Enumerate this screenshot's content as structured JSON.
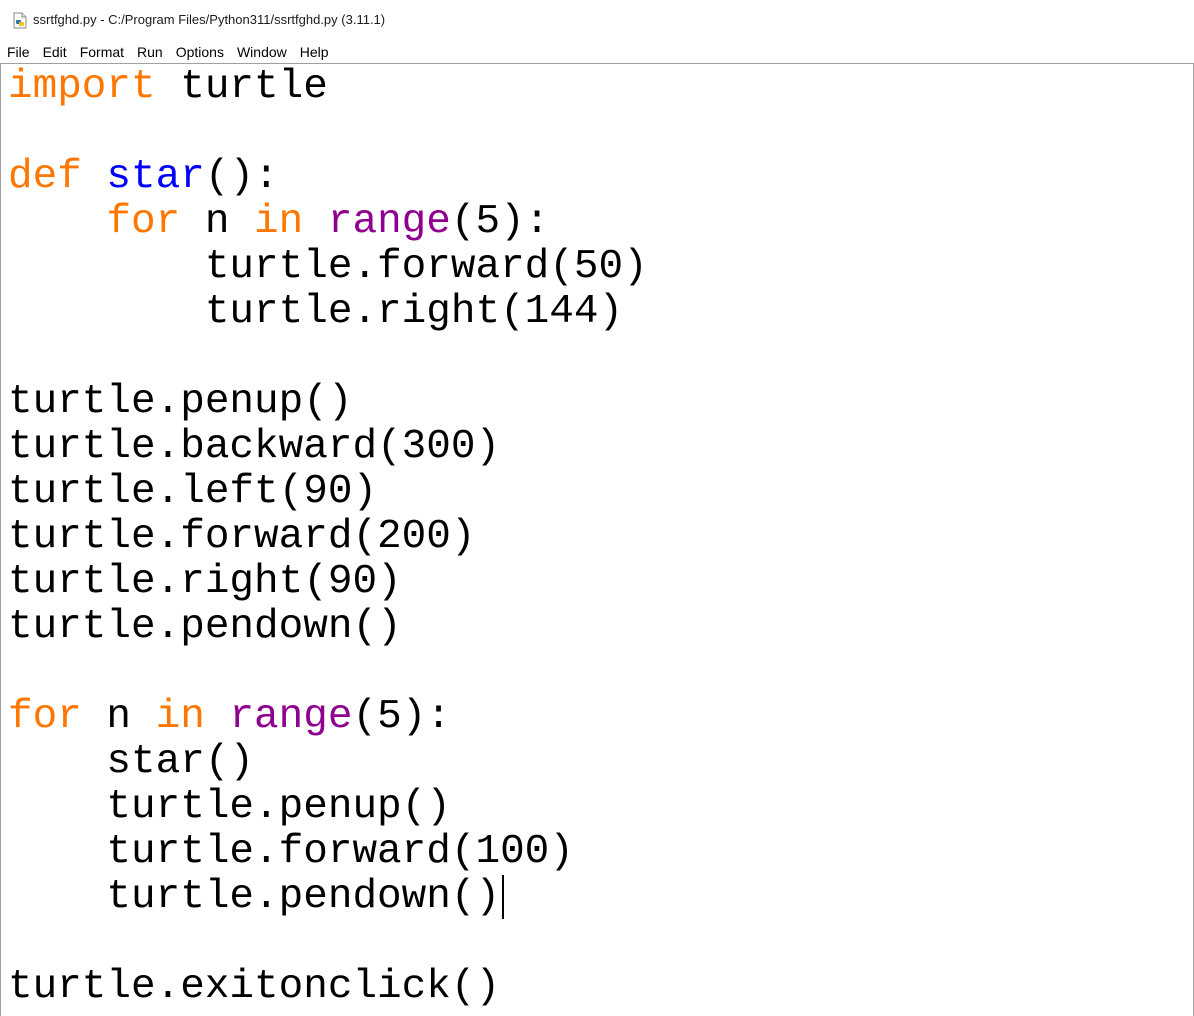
{
  "window": {
    "title": "ssrtfghd.py - C:/Program Files/Python311/ssrtfghd.py (3.11.1)",
    "icon": "python-file-icon"
  },
  "menu": {
    "items": [
      "File",
      "Edit",
      "Format",
      "Run",
      "Options",
      "Window",
      "Help"
    ]
  },
  "syntax_colors": {
    "keyword": "#ff7700",
    "definition": "#0000ff",
    "builtin": "#900090",
    "default": "#000000"
  },
  "code": {
    "l1": {
      "kw": "import",
      "rest": " turtle"
    },
    "l3": {
      "kw": "def",
      "sp": " ",
      "name": "star",
      "rest": "():"
    },
    "l4": {
      "indent": "    ",
      "kw1": "for",
      "mid1": " n ",
      "kw2": "in",
      "sp": " ",
      "builtin": "range",
      "rest": "(5):"
    },
    "l5": {
      "text": "        turtle.forward(50)"
    },
    "l6": {
      "text": "        turtle.right(144)"
    },
    "l8": {
      "text": "turtle.penup()"
    },
    "l9": {
      "text": "turtle.backward(300)"
    },
    "l10": {
      "text": "turtle.left(90)"
    },
    "l11": {
      "text": "turtle.forward(200)"
    },
    "l12": {
      "text": "turtle.right(90)"
    },
    "l13": {
      "text": "turtle.pendown()"
    },
    "l15": {
      "kw1": "for",
      "mid1": " n ",
      "kw2": "in",
      "sp": " ",
      "builtin": "range",
      "rest": "(5):"
    },
    "l16": {
      "text": "    star()"
    },
    "l17": {
      "text": "    turtle.penup()"
    },
    "l18": {
      "text": "    turtle.forward(100)"
    },
    "l19": {
      "text": "    turtle.pendown()"
    },
    "l21": {
      "text": "turtle.exitonclick()"
    }
  }
}
